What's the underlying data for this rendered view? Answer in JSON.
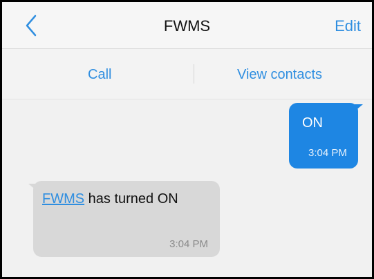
{
  "navbar": {
    "back_icon": "chevron-left-icon",
    "title": "FWMS",
    "edit_label": "Edit"
  },
  "actions": {
    "call_label": "Call",
    "view_contacts_label": "View contacts"
  },
  "messages": [
    {
      "direction": "outgoing",
      "text": "ON",
      "time": "3:04 PM"
    },
    {
      "direction": "incoming",
      "link_text": "FWMS",
      "text": " has turned ON",
      "time": "3:04 PM"
    }
  ],
  "colors": {
    "accent": "#2f8ee0",
    "outgoing_bubble": "#1e86e3",
    "incoming_bubble": "#d8d8d8",
    "background": "#f1f1f1"
  }
}
